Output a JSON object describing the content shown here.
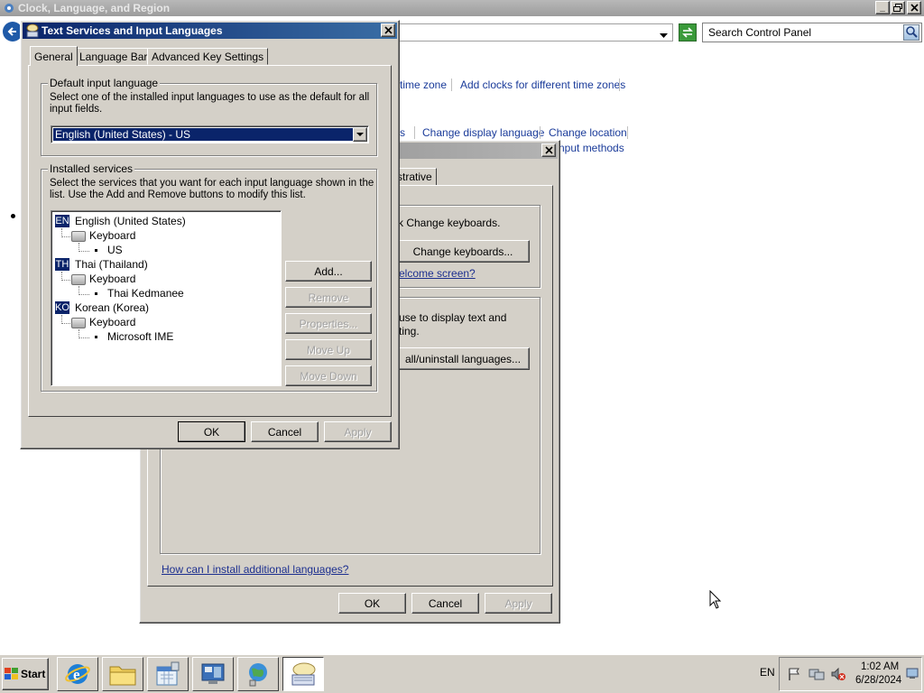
{
  "main_window": {
    "title": "Clock, Language, and Region",
    "search_placeholder": "Search Control Panel",
    "links_row1": [
      "time zone",
      "Add clocks for different time zones"
    ],
    "links_row2": [
      "s",
      "Change display language",
      "Change location"
    ],
    "links_row3": "nput methods"
  },
  "region_dialog": {
    "tab_fragment": "strative",
    "kb_text": "k Change keyboards.",
    "change_keyboards_button": "Change keyboards...",
    "welcome_link": "elcome screen?",
    "lang_text_line1": "use to display text and",
    "lang_text_line2": "ting.",
    "install_button": "all/uninstall languages...",
    "help_link": "How can I install additional languages?",
    "ok": "OK",
    "cancel": "Cancel",
    "apply": "Apply"
  },
  "text_services_dialog": {
    "title": "Text Services and Input Languages",
    "tabs": [
      "General",
      "Language Bar",
      "Advanced Key Settings"
    ],
    "default_group_title": "Default input language",
    "default_desc": "Select one of the installed input languages to use as the default for all input fields.",
    "default_value": "English (United States) - US",
    "installed_group_title": "Installed services",
    "installed_desc": "Select the services that you want for each input language shown in the list. Use the Add and Remove buttons to modify this list.",
    "languages": [
      {
        "code": "EN",
        "name": "English (United States)",
        "category": "Keyboard",
        "service": "US"
      },
      {
        "code": "TH",
        "name": "Thai (Thailand)",
        "category": "Keyboard",
        "service": "Thai Kedmanee"
      },
      {
        "code": "KO",
        "name": "Korean (Korea)",
        "category": "Keyboard",
        "service": "Microsoft IME"
      }
    ],
    "buttons": {
      "add": "Add...",
      "remove": "Remove",
      "properties": "Properties...",
      "move_up": "Move Up",
      "move_down": "Move Down"
    },
    "ok": "OK",
    "cancel": "Cancel",
    "apply": "Apply"
  },
  "taskbar": {
    "start": "Start",
    "lang": "EN",
    "time": "1:02 AM",
    "date": "6/28/2024"
  }
}
